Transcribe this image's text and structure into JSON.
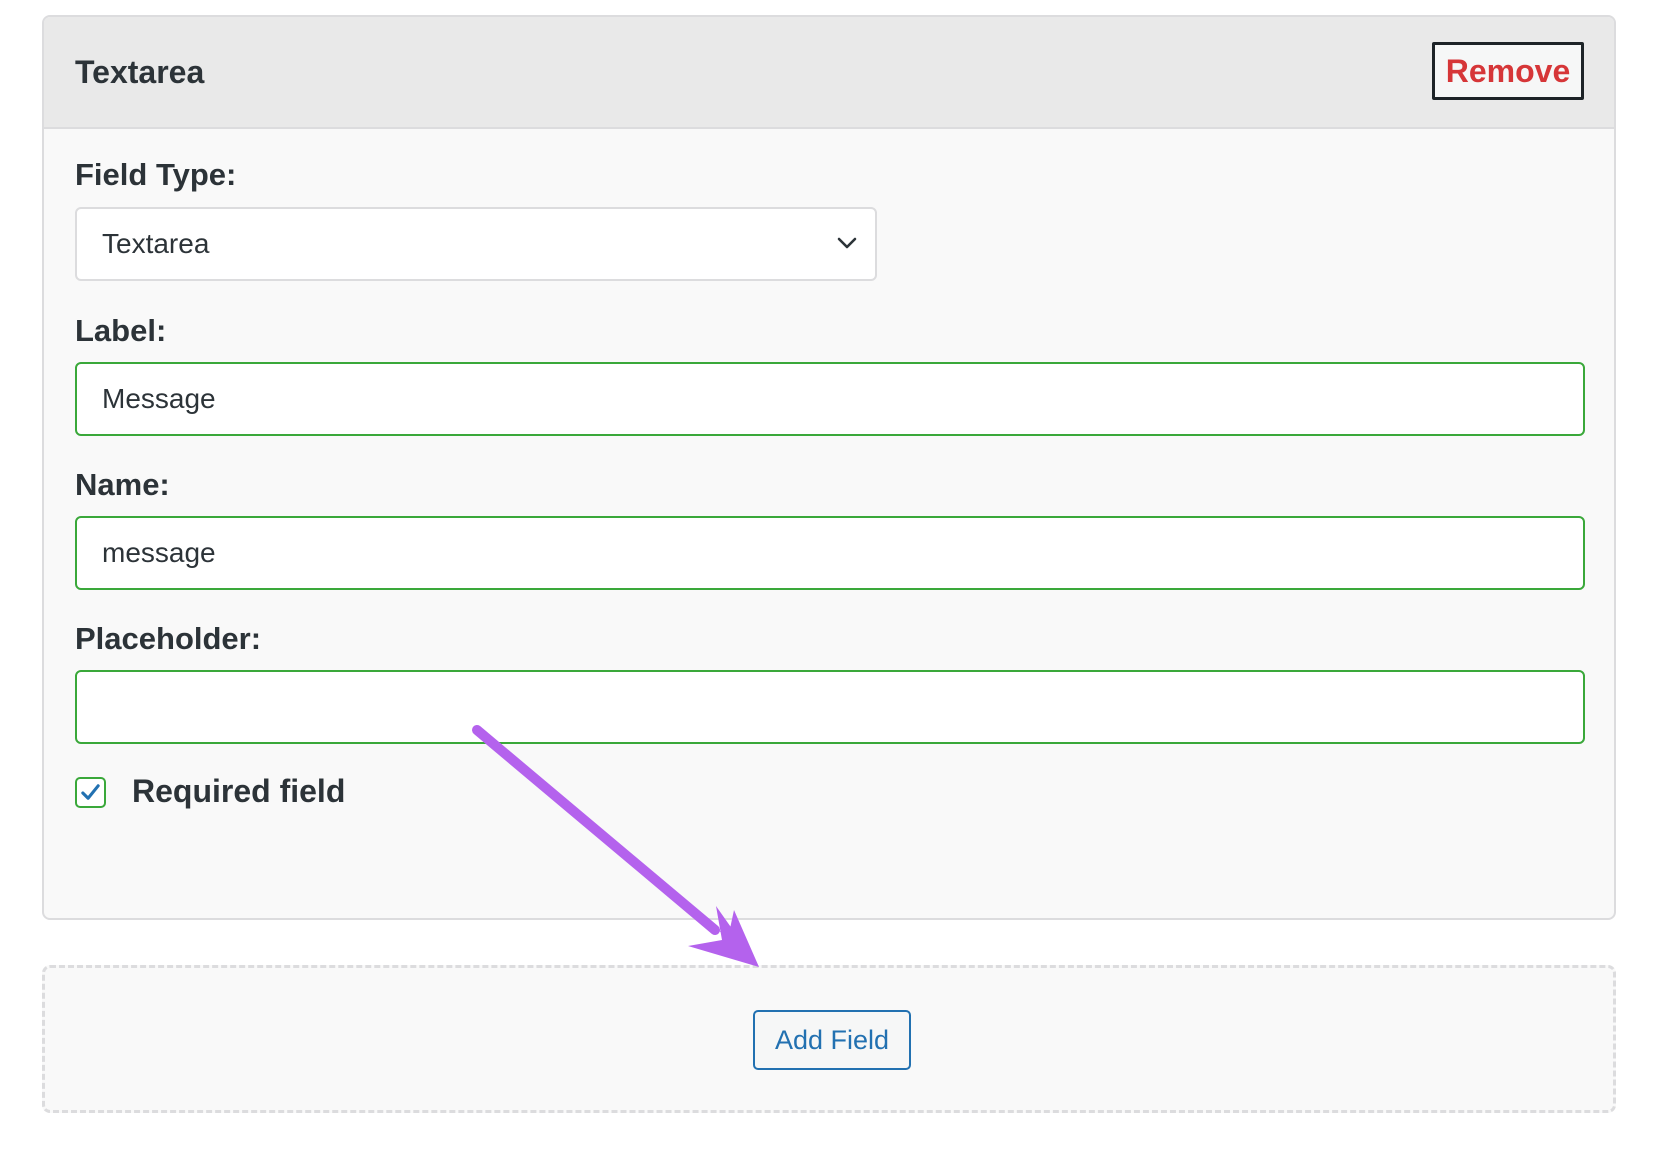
{
  "card": {
    "title": "Textarea",
    "remove_label": "Remove"
  },
  "field_type": {
    "label": "Field Type:",
    "selected": "Textarea",
    "icon": "chevron-down-icon"
  },
  "label_field": {
    "label": "Label:",
    "value": "Message"
  },
  "name_field": {
    "label": "Name:",
    "value": "message"
  },
  "placeholder_field": {
    "label": "Placeholder:",
    "value": ""
  },
  "required": {
    "label": "Required field",
    "checked": true
  },
  "add_field": {
    "label": "Add Field"
  },
  "annotation": {
    "icon": "arrow-icon",
    "color": "#b462ed"
  },
  "colors": {
    "remove_text": "#d63638",
    "valid_border": "#3aa83a",
    "primary": "#2271b1",
    "check": "#2271b1"
  }
}
